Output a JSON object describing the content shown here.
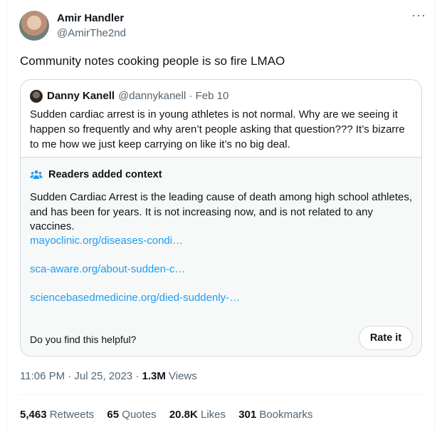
{
  "author": {
    "name": "Amir Handler",
    "handle": "@AmirThe2nd",
    "avatar_icon": "user-avatar"
  },
  "more_icon": "ellipsis-icon",
  "tweet_text": "Community notes cooking people is so fire LMAO",
  "quoted": {
    "name": "Danny Kanell",
    "handle_date": "@dannykanell · Feb 10",
    "text": "Sudden cardiac arrest is in young athletes is not normal. Why are we seeing it happen so frequently and why aren’t people asking that question??? It’s bizarre to me how we just keep carrying on like it’s no big deal.",
    "note": {
      "title": "Readers added context",
      "icon": "people-icon",
      "body": "Sudden Cardiac Arrest is the leading cause of death among high school athletes, and has been for years. It is not increasing now, and is not related to any vaccines.",
      "links": [
        "mayoclinic.org/diseases-condi…",
        "sca-aware.org/about-sudden-c…",
        "sciencebasedmedicine.org/died-suddenly-…"
      ],
      "helpful_question": "Do you find this helpful?",
      "rate_label": "Rate it"
    }
  },
  "meta": {
    "time": "11:06 PM · Jul 25, 2023 · ",
    "views_count": "1.3M",
    "views_label": " Views"
  },
  "stats": {
    "retweets_count": "5,463",
    "retweets_label": " Retweets",
    "quotes_count": "65",
    "quotes_label": " Quotes",
    "likes_count": "20.8K",
    "likes_label": " Likes",
    "bookmarks_count": "301",
    "bookmarks_label": " Bookmarks"
  },
  "colors": {
    "link": "#1d9bf0",
    "note_icon": "#1d9bf0",
    "secondary_text": "#536471"
  }
}
